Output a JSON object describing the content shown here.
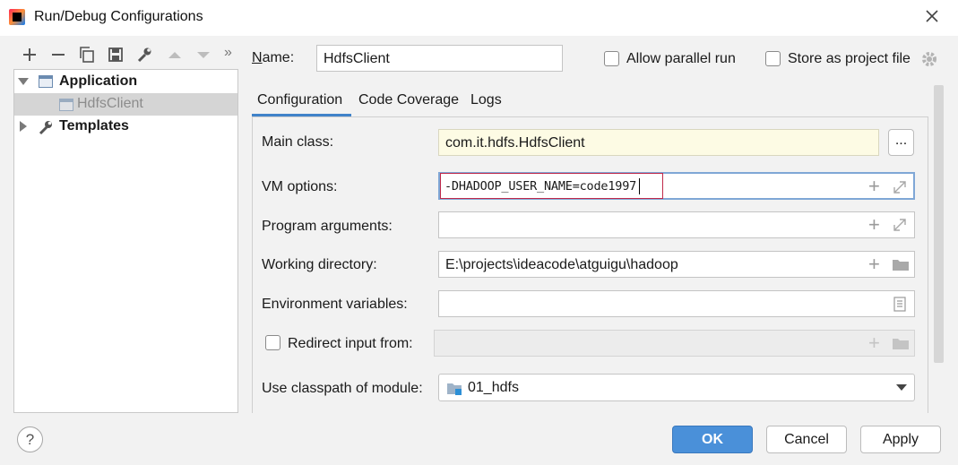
{
  "window": {
    "title": "Run/Debug Configurations"
  },
  "toolbar": {
    "icons": [
      "add-icon",
      "remove-icon",
      "copy-icon",
      "save-icon",
      "wrench-icon",
      "move-up-icon",
      "move-down-icon",
      "more-icon"
    ],
    "more_label": "»"
  },
  "tree": {
    "items": [
      {
        "label": "Application",
        "expanded": true,
        "bold": true
      },
      {
        "label": "HdfsClient",
        "selected": true
      },
      {
        "label": "Templates",
        "expanded": false,
        "bold": true
      }
    ]
  },
  "header": {
    "name_label": "Name:",
    "name_value": "HdfsClient",
    "allow_parallel_label": "Allow parallel run",
    "allow_parallel_checked": false,
    "store_project_label": "Store as project file",
    "store_project_checked": false
  },
  "tabs": [
    {
      "label": "Configuration",
      "active": true
    },
    {
      "label": "Code Coverage",
      "active": false
    },
    {
      "label": "Logs",
      "active": false
    }
  ],
  "form": {
    "main_class_label": "Main class:",
    "main_class_value": "com.it.hdfs.HdfsClient",
    "browse_label": "...",
    "vm_options_label": "VM options:",
    "vm_options_value": "-DHADOOP_USER_NAME=code1997",
    "program_args_label": "Program arguments:",
    "program_args_value": "",
    "working_dir_label": "Working directory:",
    "working_dir_value": "E:\\projects\\ideacode\\atguigu\\hadoop",
    "env_vars_label": "Environment variables:",
    "env_vars_value": "",
    "redirect_label": "Redirect input from:",
    "redirect_checked": false,
    "classpath_label": "Use classpath of module:",
    "classpath_value": "01_hdfs"
  },
  "footer": {
    "help_label": "?",
    "ok_label": "OK",
    "cancel_label": "Cancel",
    "apply_label": "Apply"
  },
  "colors": {
    "accent": "#4083c9",
    "primary_button": "#4a90d9",
    "main_class_bg": "#fdfbe4",
    "vm_highlight_border": "#c0294a"
  }
}
